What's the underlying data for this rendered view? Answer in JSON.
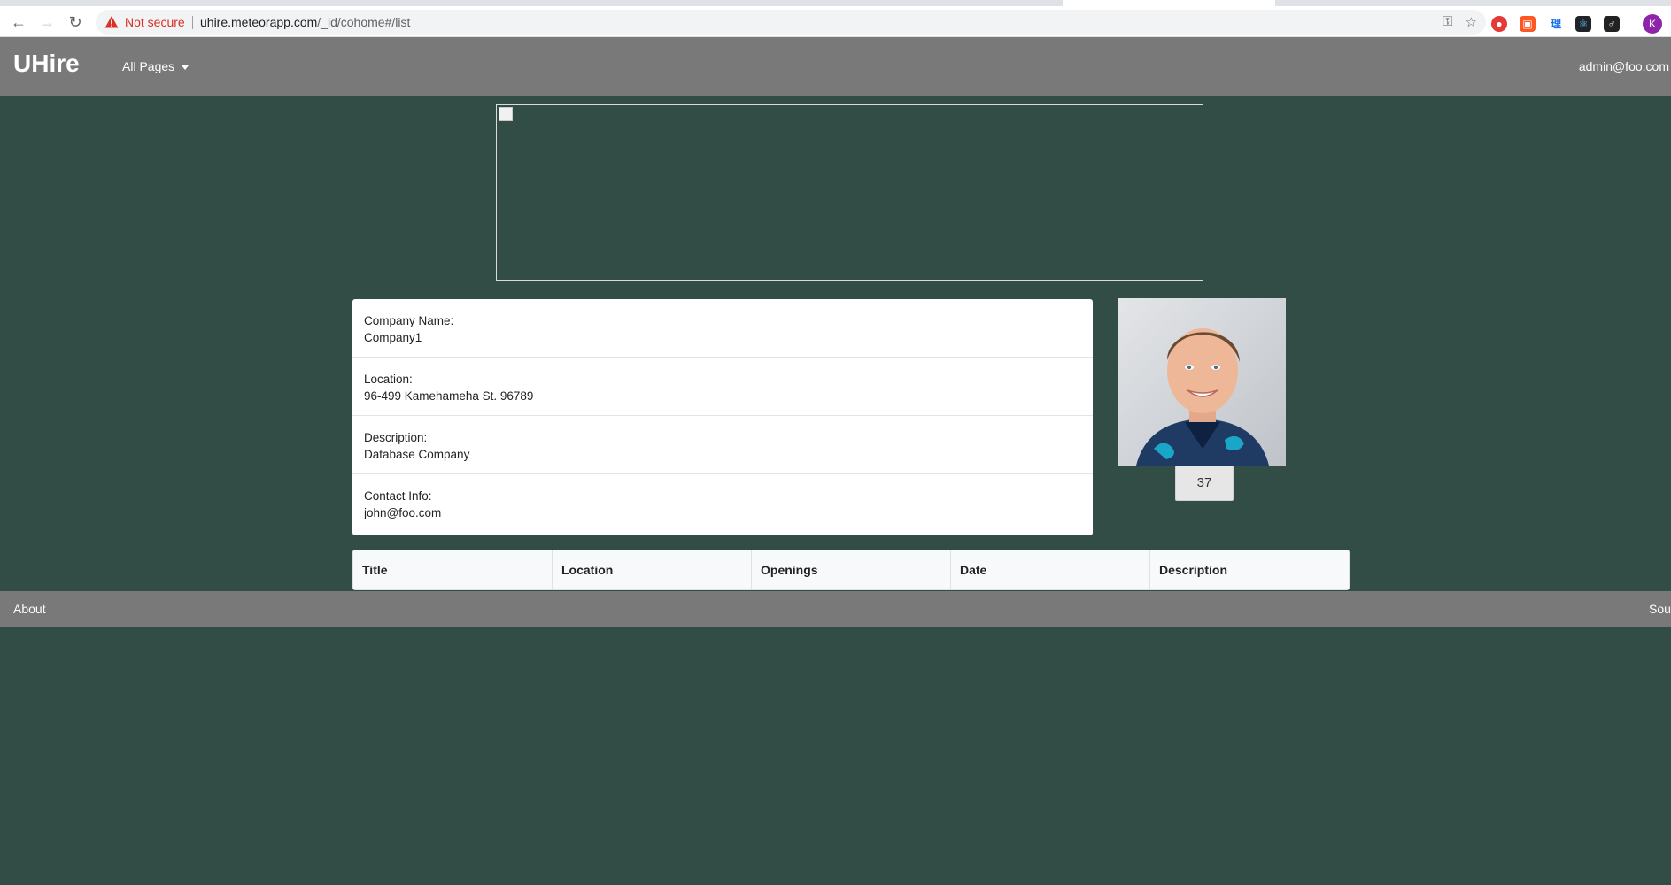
{
  "browser": {
    "security_label": "Not secure",
    "url_host": "uhire.meteorapp.com",
    "url_path": "/_id/cohome#/list",
    "profile_initial": "K"
  },
  "navbar": {
    "brand": "UHire",
    "menu_label": "All Pages",
    "user_email": "admin@foo.com"
  },
  "company": {
    "fields": [
      {
        "label": "Company Name:",
        "value": "Company1"
      },
      {
        "label": "Location:",
        "value": "96-499 Kamehameha St. 96789"
      },
      {
        "label": "Description:",
        "value": "Database Company"
      },
      {
        "label": "Contact Info:",
        "value": "john@foo.com"
      }
    ],
    "count": "37"
  },
  "table": {
    "columns": [
      "Title",
      "Location",
      "Openings",
      "Date",
      "Description"
    ]
  },
  "footer": {
    "about_label": "About",
    "source_label": "Sou"
  }
}
